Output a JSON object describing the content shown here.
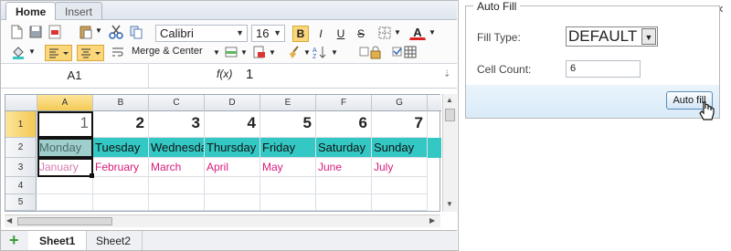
{
  "ribbon": {
    "tabs": [
      "Home",
      "Insert"
    ],
    "font_name": "Calibri",
    "font_size": "16",
    "bold_label": "B",
    "italic_label": "I",
    "underline_label": "U",
    "strike_label": "S",
    "font_color_label": "A",
    "merge_label": "Merge & Center",
    "close_label": "×"
  },
  "formula_bar": {
    "cell_ref": "A1",
    "fx_label": "f(x)",
    "value": "1"
  },
  "grid": {
    "columns": [
      "A",
      "B",
      "C",
      "D",
      "E",
      "F",
      "G"
    ],
    "rows": [
      "1",
      "2",
      "3",
      "4",
      "5"
    ],
    "row1": [
      "1",
      "2",
      "3",
      "4",
      "5",
      "6",
      "7"
    ],
    "row2": [
      "Monday",
      "Tuesday",
      "Wednesday",
      "Thursday",
      "Friday",
      "Saturday",
      "Sunday"
    ],
    "row3": [
      "January",
      "February",
      "March",
      "April",
      "May",
      "June",
      "July"
    ],
    "selected_cell": "A1",
    "day_fill_color": "#33c8c4",
    "month_text_color": "#d81b7a"
  },
  "sheet_tabs": {
    "add_label": "+",
    "tabs": [
      "Sheet1",
      "Sheet2"
    ],
    "active": "Sheet1"
  },
  "auto_fill_panel": {
    "title": "Auto Fill",
    "fill_type_label": "Fill Type:",
    "fill_type_value": "DEFAULT",
    "cell_count_label": "Cell Count:",
    "cell_count_value": "6",
    "button_label": "Auto fill"
  }
}
